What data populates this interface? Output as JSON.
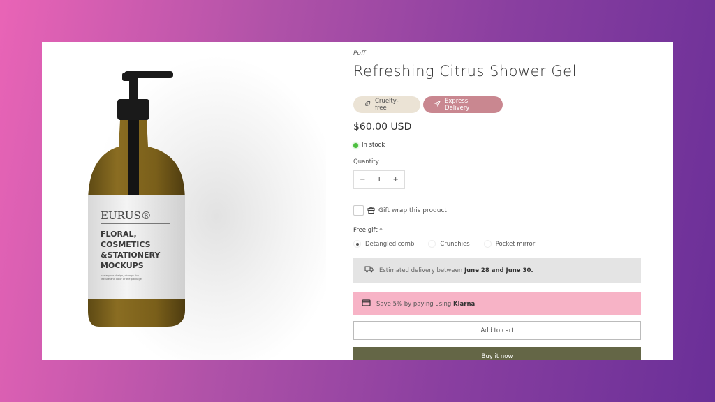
{
  "product": {
    "vendor": "Puff",
    "title": "Refreshing Citrus Shower Gel",
    "badges": [
      {
        "label": "Cruelty-free",
        "icon": "leaf-icon",
        "color": "#ebe3d5"
      },
      {
        "label": "Express Delivery",
        "icon": "send-icon",
        "color": "#c98790"
      }
    ],
    "price": "$60.00 USD",
    "stock": {
      "label": "In stock",
      "color": "#4cbf3f"
    },
    "quantity": {
      "label": "Quantity",
      "value": "1",
      "decrease": "−",
      "increase": "+"
    },
    "gift_wrap": {
      "label": "Gift wrap this product",
      "checked": false
    },
    "free_gift": {
      "label": "Free gift *",
      "options": [
        {
          "label": "Detangled comb",
          "selected": true
        },
        {
          "label": "Crunchies",
          "selected": false
        },
        {
          "label": "Pocket mirror",
          "selected": false
        }
      ]
    },
    "delivery": {
      "prefix": "Estimated delivery between ",
      "dates": "June 28 and June 30."
    },
    "klarna": {
      "prefix": "Save 5% by paying using ",
      "brand": "Klarna",
      "color": "#f7b3c6"
    },
    "add_to_cart": "Add to cart",
    "buy_now": "Buy it now",
    "buy_now_color": "#646646"
  },
  "image": {
    "label_brand": "EURUS®",
    "label_lines": [
      "FLORAL,",
      "COSMETICS",
      "&STATIONERY",
      "MOCKUPS"
    ],
    "label_small": [
      "paste your design, change the",
      "texture and color of the package"
    ]
  }
}
